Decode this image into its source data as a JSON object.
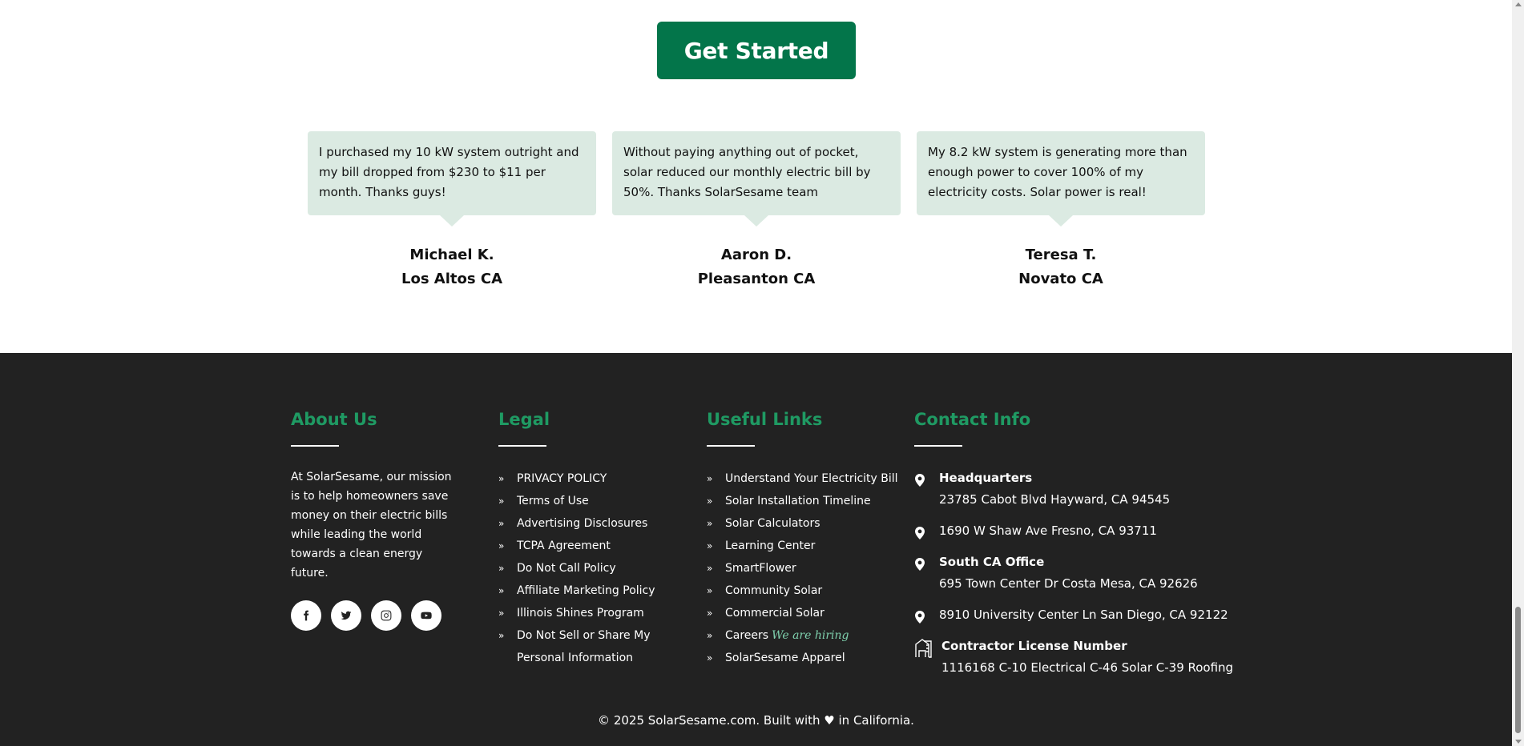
{
  "cta": {
    "label": "Get Started"
  },
  "testimonials": [
    {
      "quote": "I purchased my 10 kW system outright and my bill dropped from $230 to $11 per month. Thanks guys!",
      "name": "Michael K.",
      "location": "Los Altos CA"
    },
    {
      "quote": "Without paying anything out of pocket, solar reduced our monthly electric bill by 50%. Thanks SolarSesame team",
      "name": "Aaron D.",
      "location": "Pleasanton CA"
    },
    {
      "quote": "My 8.2 kW system is generating more than enough power to cover 100% of my electricity costs. Solar power is real!",
      "name": "Teresa T.",
      "location": "Novato CA"
    }
  ],
  "footer": {
    "about": {
      "heading": "About Us",
      "text": "At SolarSesame, our mission is to help homeowners save money on their electric bills while leading the world towards a clean energy future.",
      "socials": [
        "facebook-icon",
        "twitter-icon",
        "instagram-icon",
        "youtube-icon"
      ]
    },
    "legal": {
      "heading": "Legal",
      "items": [
        "PRIVACY POLICY",
        "Terms of Use",
        "Advertising Disclosures",
        "TCPA Agreement",
        "Do Not Call Policy",
        "Affiliate Marketing Policy",
        "Illinois Shines Program",
        "Do Not Sell or Share My Personal Information"
      ]
    },
    "useful": {
      "heading": "Useful Links",
      "items": [
        "Understand Your Electricity Bill",
        "Solar Installation Timeline",
        "Solar Calculators",
        "Learning Center",
        "SmartFlower",
        "Community Solar",
        "Commercial Solar",
        "Careers",
        "SolarSesame Apparel"
      ],
      "hiring_tag": "We are hiring"
    },
    "contact": {
      "heading": "Contact Info",
      "hq_title": "Headquarters",
      "hq_address": "23785 Cabot Blvd Hayward, CA 94545",
      "fresno_address": "1690 W Shaw Ave Fresno, CA 93711",
      "south_title": "South CA Office",
      "south_address": "695 Town Center Dr Costa Mesa, CA 92626",
      "sandiego_address": "8910 University Center Ln San Diego, CA 92122",
      "license_title": "Contractor License Number",
      "license_text": "1116168 C-10 Electrical C-46 Solar C-39 Roofing"
    },
    "copyright": "© 2025 SolarSesame.com. Built with ♥ in California."
  },
  "colors": {
    "brand_green": "#03754a",
    "heading_green": "#1f9a63",
    "bubble_bg": "#dbeae2",
    "footer_bg": "#222222"
  }
}
